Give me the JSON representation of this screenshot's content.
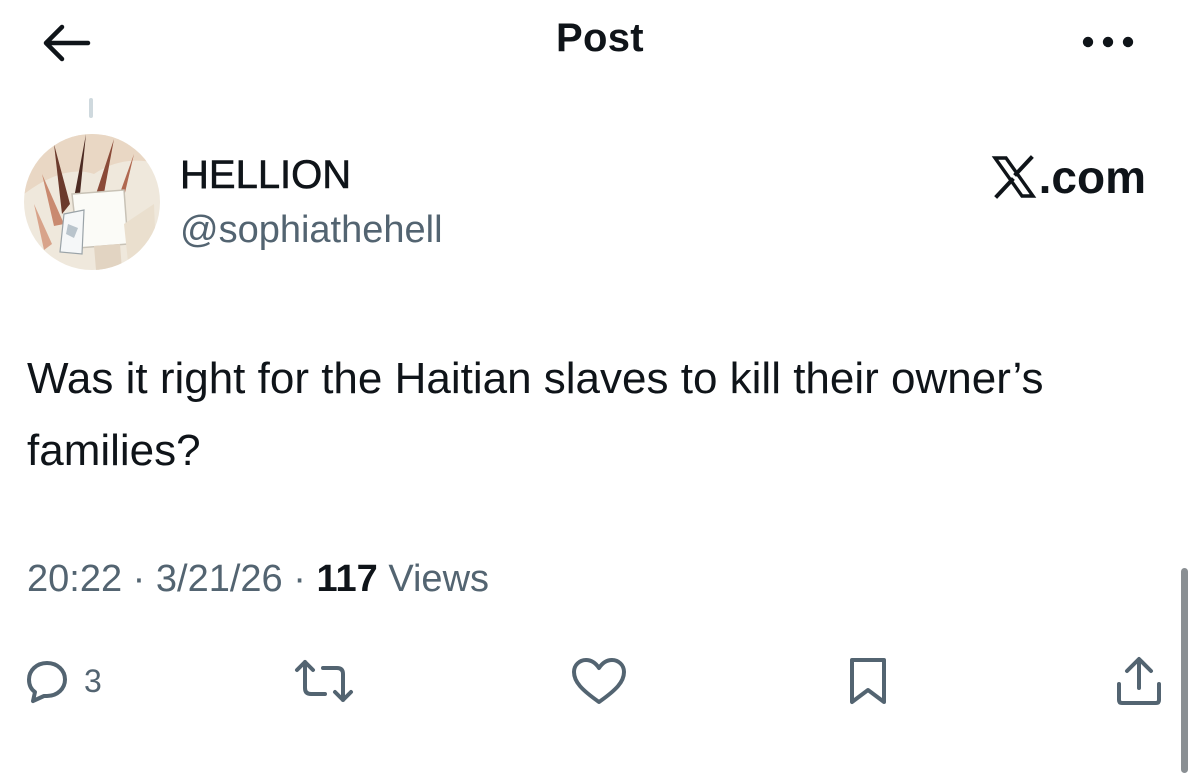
{
  "header": {
    "title": "Post",
    "back_icon": "arrow-left-icon",
    "more_icon": "more-horizontal-icon"
  },
  "author": {
    "display_name": "HELLION",
    "handle": "@sophiathehell",
    "avatar": "anime-character-avatar"
  },
  "brand": {
    "text": ".com",
    "icon": "x-logo-icon"
  },
  "post": {
    "text": "Was it right for the Haitian slaves to kill their owner’s families?"
  },
  "meta": {
    "time": "20:22",
    "date": "3/21/26",
    "views_count": "117",
    "views_label": "Views",
    "separator": "·"
  },
  "actions": {
    "reply": {
      "icon": "reply-icon",
      "count": "3"
    },
    "repost": {
      "icon": "repost-icon"
    },
    "like": {
      "icon": "heart-icon"
    },
    "bookmark": {
      "icon": "bookmark-icon"
    },
    "share": {
      "icon": "share-icon"
    }
  },
  "colors": {
    "text_primary": "#0f1419",
    "text_secondary": "#536471",
    "background": "#ffffff"
  }
}
